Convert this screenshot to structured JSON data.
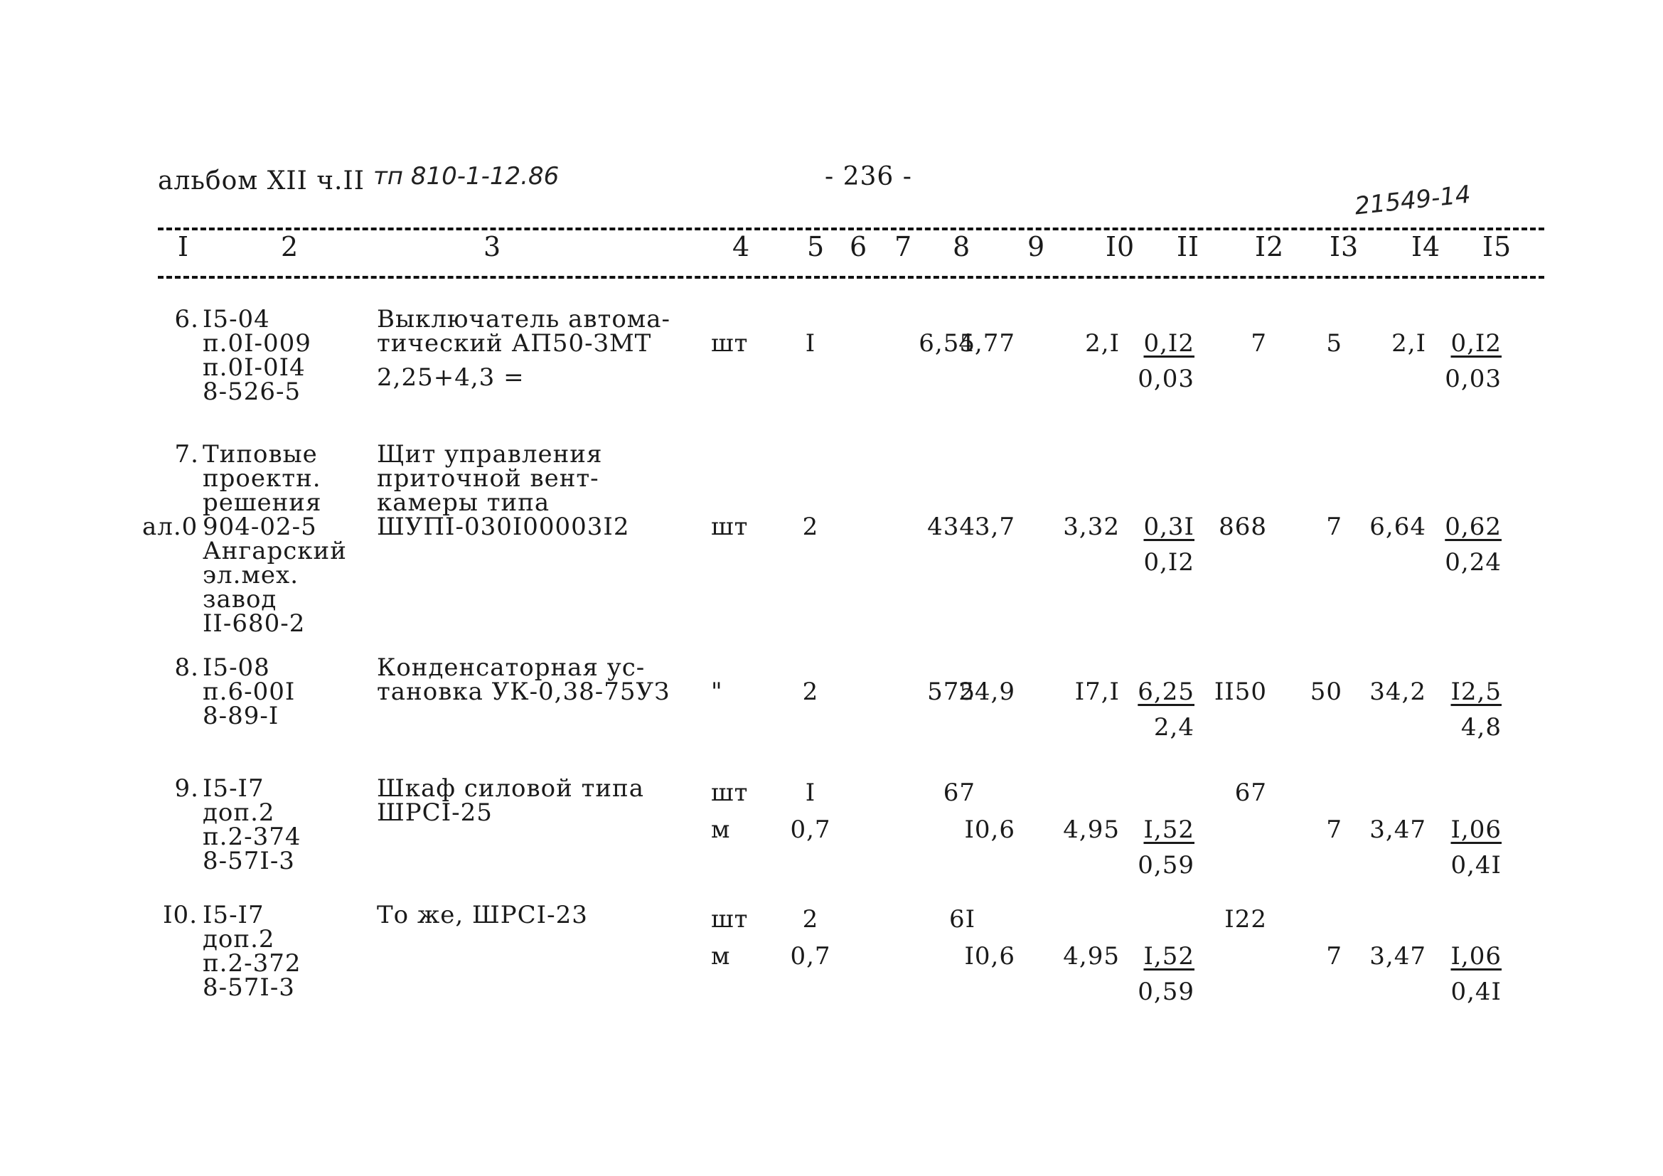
{
  "header": {
    "album": "альбом XII ч.II",
    "project_handwritten": "тп 810-1-12.86",
    "page_number": "- 236 -",
    "stamp_handwritten": "21549-14"
  },
  "columns": [
    "I",
    "2",
    "3",
    "4",
    "5",
    "6",
    "7",
    "8",
    "9",
    "I0",
    "II",
    "I2",
    "I3",
    "I4",
    "I5"
  ],
  "rows": [
    {
      "num": "6.",
      "refs": [
        "I5-04",
        "п.0I-009",
        "п.0I-0I4",
        "8-526-5"
      ],
      "side_note": "",
      "name": [
        "Выключатель автома-",
        "тический АП50-ЗМТ"
      ],
      "name_extra": "2,25+4,3 =",
      "lines": [
        {
          "unit": "шт",
          "qty": "I",
          "c8": "6,55",
          "c9": "4,77",
          "c10": "2,I",
          "c11_top": "0,I2",
          "c11_bottom": "0,03",
          "c12": "7",
          "c13": "5",
          "c14": "2,I",
          "c15_top": "0,I2",
          "c15_bottom": "0,03"
        }
      ]
    },
    {
      "num": "7.",
      "refs": [
        "Типовые",
        "проектн.",
        "решения",
        "904-02-5",
        "Ангарский",
        "эл.мех.",
        "завод",
        "II-680-2"
      ],
      "side_note": "ал.0",
      "name": [
        "Щит управления",
        "приточной вент-",
        "камеры типа",
        "ШУПI-030I00003I2"
      ],
      "name_extra": "",
      "lines": [
        {
          "unit": "шт",
          "qty": "2",
          "c8": "434",
          "c9": "3,7",
          "c10": "3,32",
          "c11_top": "0,3I",
          "c11_bottom": "0,I2",
          "c12": "868",
          "c13": "7",
          "c14": "6,64",
          "c15_top": "0,62",
          "c15_bottom": "0,24"
        }
      ]
    },
    {
      "num": "8.",
      "refs": [
        "I5-08",
        "п.6-00I",
        "8-89-I"
      ],
      "side_note": "",
      "name": [
        "Конденсаторная ус-",
        "тановка УК-0,38-75УЗ"
      ],
      "name_extra": "",
      "lines": [
        {
          "unit": "\"",
          "qty": "2",
          "c8": "575",
          "c9": "24,9",
          "c10": "I7,I",
          "c11_top": "6,25",
          "c11_bottom": "2,4",
          "c12": "II50",
          "c13": "50",
          "c14": "34,2",
          "c15_top": "I2,5",
          "c15_bottom": "4,8"
        }
      ]
    },
    {
      "num": "9.",
      "refs": [
        "I5-I7",
        "доп.2",
        "п.2-374",
        "8-57I-3"
      ],
      "side_note": "",
      "name": [
        "Шкаф силовой типа",
        "ШРСI-25"
      ],
      "name_extra": "",
      "lines": [
        {
          "unit": "шт",
          "qty": "I",
          "c8": "67",
          "c12": "67"
        },
        {
          "unit": "м",
          "qty": "0,7",
          "c9": "I0,6",
          "c10": "4,95",
          "c11_top": "I,52",
          "c11_bottom": "0,59",
          "c13": "7",
          "c14": "3,47",
          "c15_top": "I,06",
          "c15_bottom": "0,4I"
        }
      ]
    },
    {
      "num": "I0.",
      "refs": [
        "I5-I7",
        "доп.2",
        "п.2-372",
        "8-57I-3"
      ],
      "side_note": "",
      "name": [
        "То же, ШРСI-23"
      ],
      "name_extra": "",
      "lines": [
        {
          "unit": "шт",
          "qty": "2",
          "c8": "6I",
          "c12": "I22"
        },
        {
          "unit": "м",
          "qty": "0,7",
          "c9": "I0,6",
          "c10": "4,95",
          "c11_top": "I,52",
          "c11_bottom": "0,59",
          "c13": "7",
          "c14": "3,47",
          "c15_top": "I,06",
          "c15_bottom": "0,4I"
        }
      ]
    }
  ]
}
